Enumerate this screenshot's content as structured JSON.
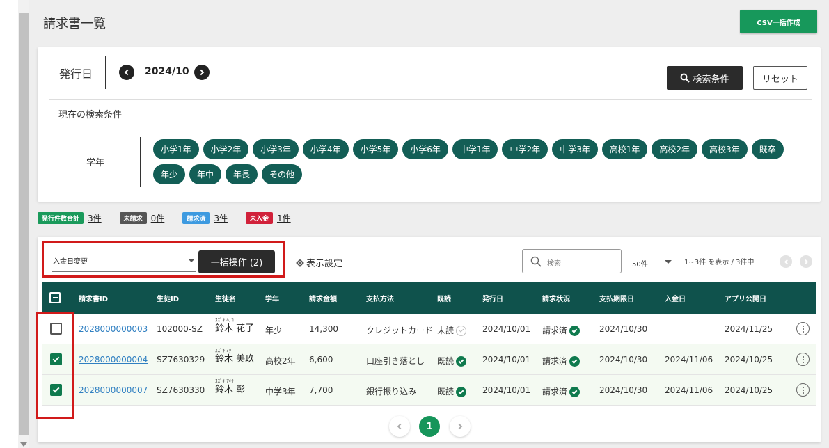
{
  "page": {
    "title": "請求書一覧"
  },
  "header": {
    "csv_button": "CSV一括作成"
  },
  "search": {
    "issue_date_label": "発行日",
    "month": "2024/10",
    "search_conditions_button": "検索条件",
    "reset_button": "リセット",
    "current_conditions_label": "現在の検索条件",
    "grade_label": "学年",
    "grades": [
      "小学1年",
      "小学2年",
      "小学3年",
      "小学4年",
      "小学5年",
      "小学6年",
      "中学1年",
      "中学2年",
      "中学3年",
      "高校1年",
      "高校2年",
      "高校3年",
      "既卒",
      "年少",
      "年中",
      "年長",
      "その他"
    ]
  },
  "summary": [
    {
      "label": "発行件数合計",
      "count": "3件",
      "color": "#1a9a5b"
    },
    {
      "label": "未請求",
      "count": "0件",
      "color": "#555555"
    },
    {
      "label": "請求済",
      "count": "3件",
      "color": "#3d9ae0"
    },
    {
      "label": "未入金",
      "count": "1件",
      "color": "#d1213a"
    }
  ],
  "toolbar": {
    "select_value": "入金日変更",
    "bulk_button": "一括操作 (2)",
    "display_settings": "表示設定",
    "search_placeholder": "検索",
    "per_page": "50件",
    "range_text": "1~3件 を表示 / 3件中"
  },
  "table": {
    "headers": [
      "請求書ID",
      "生徒ID",
      "生徒名",
      "学年",
      "請求金額",
      "支払方法",
      "既読",
      "発行日",
      "請求状況",
      "支払期限日",
      "入金日",
      "アプリ公開日"
    ],
    "rows": [
      {
        "checked": false,
        "invoice_id": "2028000000003",
        "student_id": "102000-SZ",
        "kana": "ｽｽﾞｷ ﾊﾅｺ",
        "name": "鈴木 花子",
        "grade": "年少",
        "amount": "14,300",
        "payment": "クレジットカード",
        "read": "未読",
        "read_done": false,
        "issue_date": "2024/10/01",
        "status": "請求済",
        "due_date": "2024/10/30",
        "paid_date": "",
        "app_date": "2024/11/25"
      },
      {
        "checked": true,
        "invoice_id": "2028000000004",
        "student_id": "SZ7630329",
        "kana": "ｽｽﾞｷ ﾐｸ",
        "name": "鈴木 美玖",
        "grade": "高校2年",
        "amount": "6,600",
        "payment": "口座引き落とし",
        "read": "既読",
        "read_done": true,
        "issue_date": "2024/10/01",
        "status": "請求済",
        "due_date": "2024/10/30",
        "paid_date": "2024/11/06",
        "app_date": "2024/10/25"
      },
      {
        "checked": true,
        "invoice_id": "2028000000007",
        "student_id": "SZ7630330",
        "kana": "ｽｽﾞｷ ｱｷﾗ",
        "name": "鈴木 彰",
        "grade": "中学3年",
        "amount": "7,700",
        "payment": "銀行振り込み",
        "read": "既読",
        "read_done": true,
        "issue_date": "2024/10/01",
        "status": "請求済",
        "due_date": "2024/10/30",
        "paid_date": "2024/11/06",
        "app_date": "2024/10/25"
      }
    ]
  },
  "pagination": {
    "current_page": "1"
  },
  "colors": {
    "brand_green": "#0f524c",
    "accent_green": "#17985b",
    "highlight_red": "#d11a1a"
  }
}
